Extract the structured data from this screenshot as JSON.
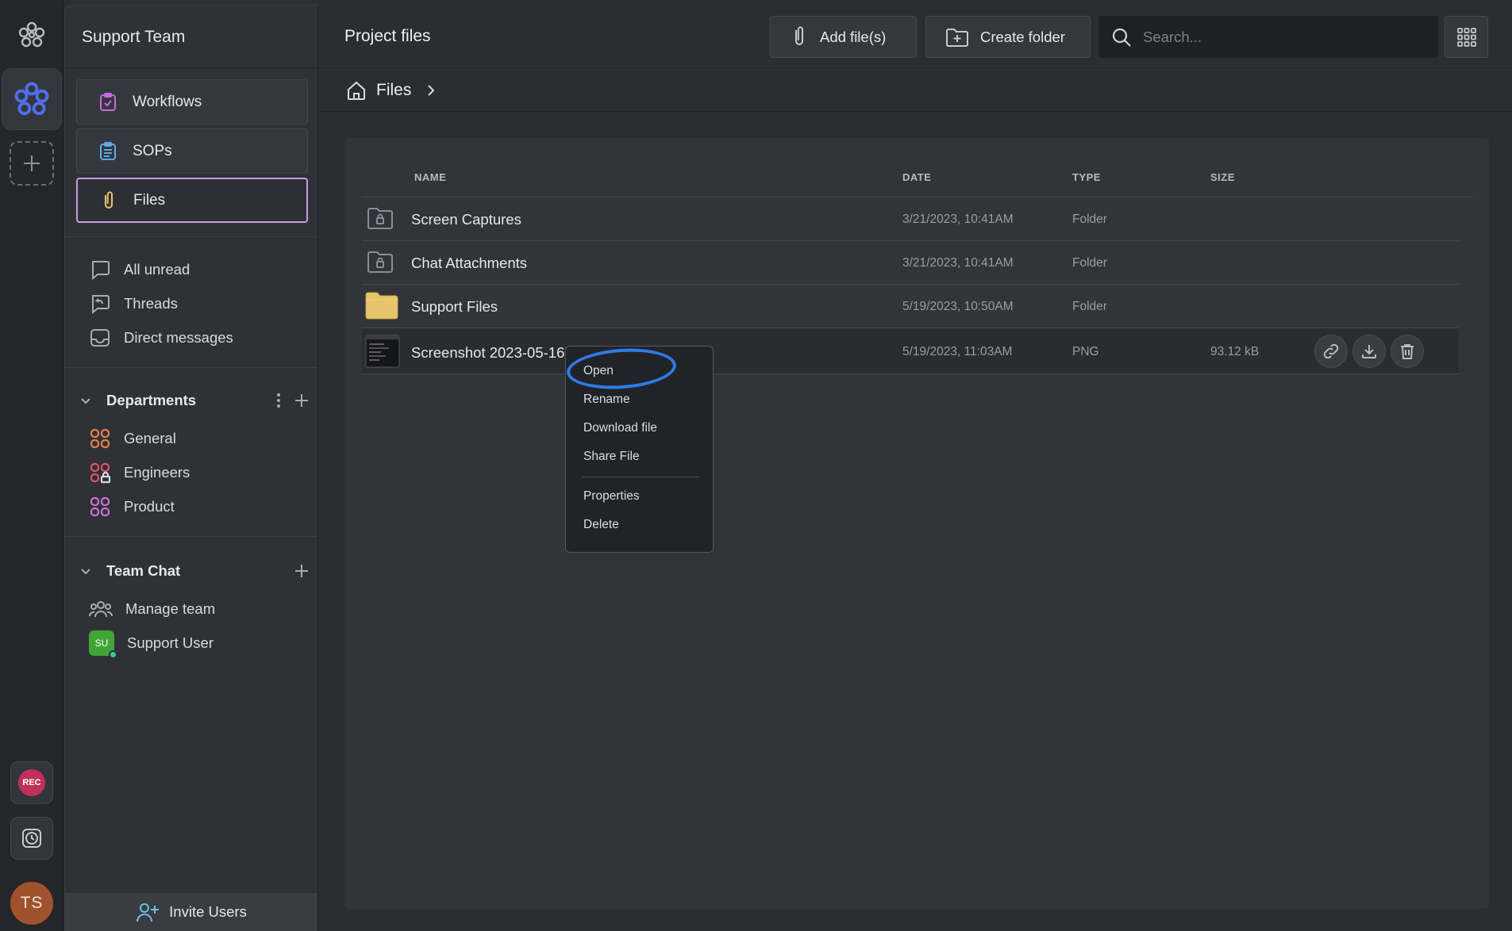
{
  "sidebar": {
    "team_name": "Support Team",
    "nav": [
      {
        "label": "Workflows"
      },
      {
        "label": "SOPs"
      },
      {
        "label": "Files"
      }
    ],
    "inbox": [
      {
        "label": "All unread"
      },
      {
        "label": "Threads"
      },
      {
        "label": "Direct messages"
      }
    ],
    "departments": {
      "title": "Departments",
      "items": [
        {
          "label": "General",
          "color": "#e8804a"
        },
        {
          "label": "Engineers",
          "color": "#e0506a"
        },
        {
          "label": "Product",
          "color": "#d070d0"
        }
      ]
    },
    "team_chat": {
      "title": "Team Chat",
      "items": [
        {
          "label": "Manage team"
        },
        {
          "label": "Support User",
          "avatar": "SU"
        }
      ]
    },
    "invite_label": "Invite Users"
  },
  "rail": {
    "rec_label": "REC",
    "user_initials": "TS"
  },
  "header": {
    "title": "Project files",
    "add_files_label": "Add file(s)",
    "create_folder_label": "Create folder",
    "search_placeholder": "Search..."
  },
  "breadcrumb": {
    "label": "Files"
  },
  "table": {
    "columns": [
      "NAME",
      "DATE",
      "TYPE",
      "SIZE"
    ],
    "rows": [
      {
        "name": "Screen Captures",
        "date": "3/21/2023, 10:41AM",
        "type": "Folder",
        "size": ""
      },
      {
        "name": "Chat Attachments",
        "date": "3/21/2023, 10:41AM",
        "type": "Folder",
        "size": ""
      },
      {
        "name": "Support Files",
        "date": "5/19/2023, 10:50AM",
        "type": "Folder",
        "size": ""
      },
      {
        "name": "Screenshot 2023-05-16",
        "date": "5/19/2023, 11:03AM",
        "type": "PNG",
        "size": "93.12 kB"
      }
    ]
  },
  "context_menu": {
    "items": [
      "Open",
      "Rename",
      "Download file",
      "Share File",
      "Properties",
      "Delete"
    ]
  },
  "colors": {
    "accent_highlight": "#2f7be8",
    "active_nav_border": "#c59be8",
    "folder_yellow": "#e8c46a"
  }
}
